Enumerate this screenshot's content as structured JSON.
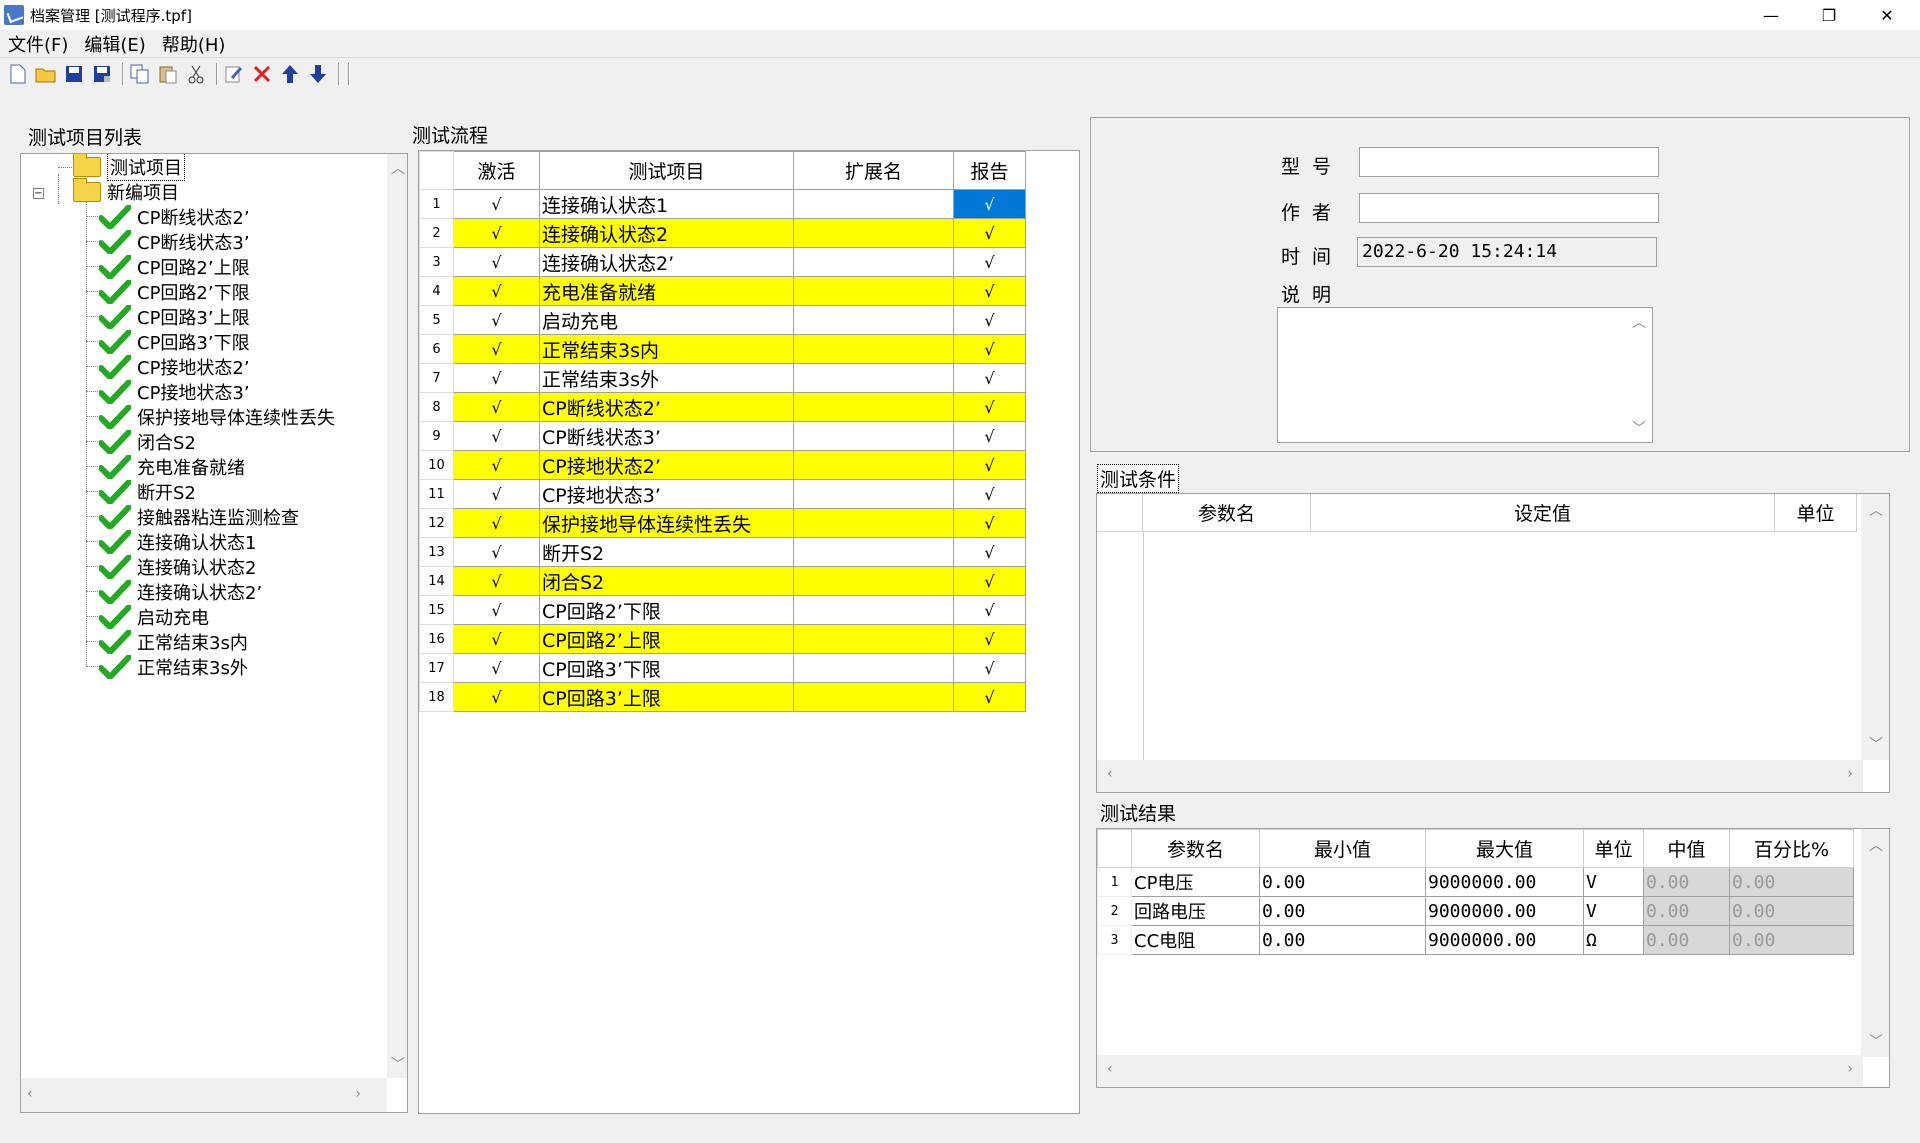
{
  "window": {
    "title": "档案管理 [测试程序.tpf]"
  },
  "menu": {
    "file": "文件(F)",
    "edit": "编辑(E)",
    "help": "帮助(H)"
  },
  "labels": {
    "tree_title": "测试项目列表",
    "flow_title": "测试流程",
    "model": "型号",
    "author": "作者",
    "time": "时间",
    "desc": "说明",
    "conditions": "测试条件",
    "results": "测试结果"
  },
  "tree": {
    "root1": "测试项目",
    "root2": "新编项目",
    "items": [
      "CP断线状态2’",
      "CP断线状态3’",
      "CP回路2’上限",
      "CP回路2’下限",
      "CP回路3’上限",
      "CP回路3’下限",
      "CP接地状态2’",
      "CP接地状态3’",
      "保护接地导体连续性丢失",
      "闭合S2",
      "充电准备就绪",
      "断开S2",
      "接触器粘连监测检查",
      "连接确认状态1",
      "连接确认状态2",
      "连接确认状态2’",
      "启动充电",
      "正常结束3s内",
      "正常结束3s外"
    ]
  },
  "flow": {
    "headers": [
      "激活",
      "测试项目",
      "扩展名",
      "报告"
    ],
    "check": "√",
    "rows": [
      {
        "n": "1",
        "item": "连接确认状态1",
        "hl": false
      },
      {
        "n": "2",
        "item": "连接确认状态2",
        "hl": true
      },
      {
        "n": "3",
        "item": "连接确认状态2’",
        "hl": false
      },
      {
        "n": "4",
        "item": "充电准备就绪",
        "hl": true
      },
      {
        "n": "5",
        "item": "启动充电",
        "hl": false
      },
      {
        "n": "6",
        "item": "正常结束3s内",
        "hl": true
      },
      {
        "n": "7",
        "item": "正常结束3s外",
        "hl": false
      },
      {
        "n": "8",
        "item": "CP断线状态2’",
        "hl": true
      },
      {
        "n": "9",
        "item": "CP断线状态3’",
        "hl": false
      },
      {
        "n": "10",
        "item": "CP接地状态2’",
        "hl": true
      },
      {
        "n": "11",
        "item": "CP接地状态3’",
        "hl": false
      },
      {
        "n": "12",
        "item": "保护接地导体连续性丢失",
        "hl": true
      },
      {
        "n": "13",
        "item": "断开S2",
        "hl": false
      },
      {
        "n": "14",
        "item": "闭合S2",
        "hl": true
      },
      {
        "n": "15",
        "item": "CP回路2’下限",
        "hl": false
      },
      {
        "n": "16",
        "item": "CP回路2’上限",
        "hl": true
      },
      {
        "n": "17",
        "item": "CP回路3’下限",
        "hl": false
      },
      {
        "n": "18",
        "item": "CP回路3’上限",
        "hl": true
      }
    ]
  },
  "info": {
    "model": "",
    "author": "",
    "time": "2022-6-20 15:24:14",
    "desc": ""
  },
  "conditions": {
    "headers": [
      "参数名",
      "设定值",
      "单位"
    ]
  },
  "results": {
    "headers": [
      "参数名",
      "最小值",
      "最大值",
      "单位",
      "中值",
      "百分比%"
    ],
    "rows": [
      {
        "n": "1",
        "name": "CP电压",
        "min": "0.00",
        "max": "9000000.00",
        "unit": "V",
        "mid": "0.00",
        "pct": "0.00"
      },
      {
        "n": "2",
        "name": "回路电压",
        "min": "0.00",
        "max": "9000000.00",
        "unit": "V",
        "mid": "0.00",
        "pct": "0.00"
      },
      {
        "n": "3",
        "name": "CC电阻",
        "min": "0.00",
        "max": "9000000.00",
        "unit": "Ω",
        "mid": "0.00",
        "pct": "0.00"
      }
    ]
  }
}
